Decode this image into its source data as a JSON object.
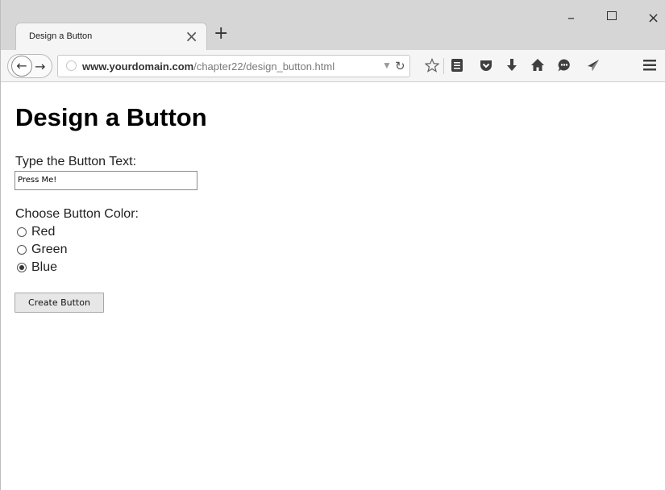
{
  "browser": {
    "tab_title": "Design a Button",
    "tab_close": "×",
    "new_tab": "+",
    "window_controls": {
      "minimize": "–",
      "close": "×"
    },
    "url_domain": "www.yourdomain.com",
    "url_path": "/chapter22/design_button.html",
    "icons": [
      "back-icon",
      "forward-icon",
      "globe-icon",
      "reload-icon",
      "star-icon",
      "reader-icon",
      "pocket-icon",
      "download-icon",
      "home-icon",
      "chat-icon",
      "send-icon",
      "menu-icon"
    ]
  },
  "page": {
    "heading": "Design a Button",
    "text_label": "Type the Button Text:",
    "text_value": "Press Me!",
    "color_label": "Choose Button Color:",
    "colors": [
      {
        "label": "Red",
        "checked": false
      },
      {
        "label": "Green",
        "checked": false
      },
      {
        "label": "Blue",
        "checked": true
      }
    ],
    "create_button": "Create Button"
  }
}
